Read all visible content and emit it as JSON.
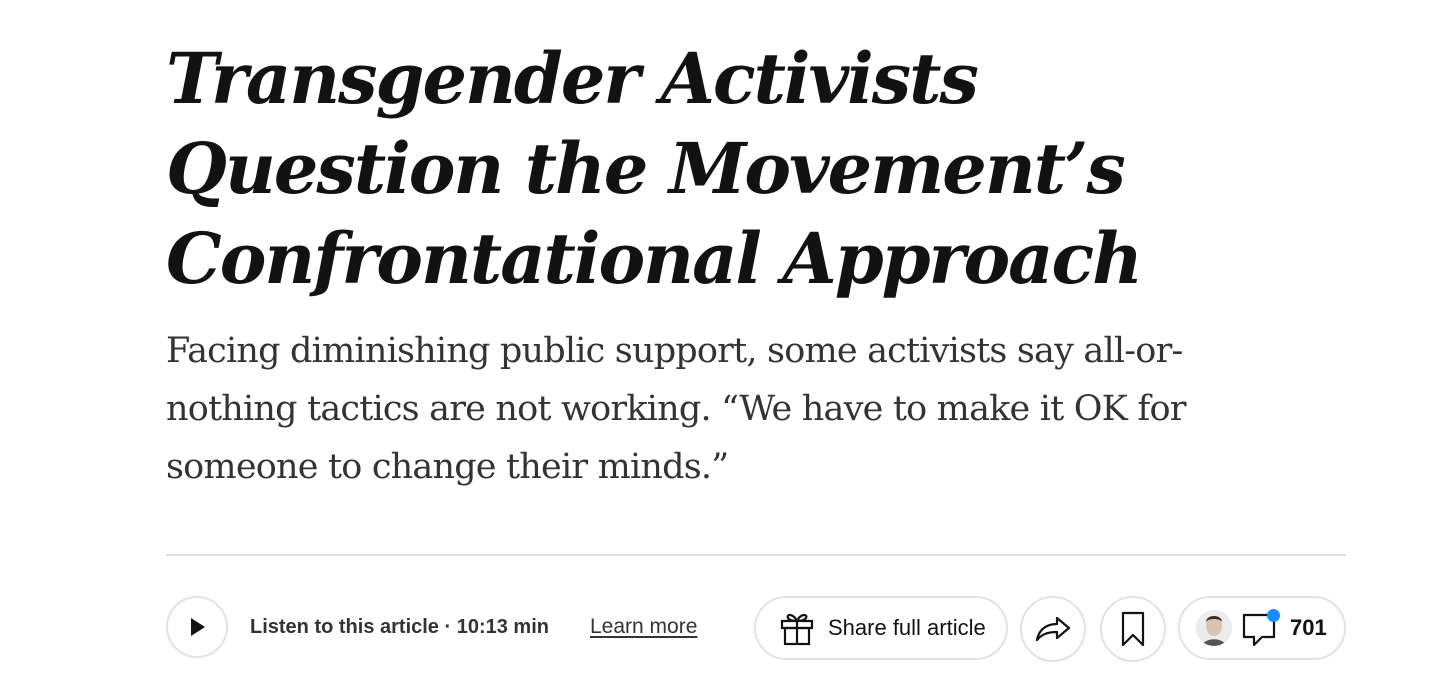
{
  "article": {
    "headline": "Transgender Activists Question the Movement’s Confrontational Approach",
    "summary": "Facing diminishing public support, some activists say all-or-nothing tactics are not working. “We have to make it OK for someone to change their minds.”"
  },
  "toolbar": {
    "listen_label": "Listen to this article · 10:13 min",
    "learn_more_label": "Learn more",
    "share_label": "Share full article",
    "comment_count": "701",
    "icons": {
      "play": "play-icon",
      "gift": "gift-icon",
      "share": "share-arrow-icon",
      "bookmark": "bookmark-icon",
      "comments": "comment-bubble-icon"
    }
  },
  "colors": {
    "text": "#121212",
    "summary_text": "#333333",
    "border": "#e2e2e2",
    "notification_dot": "#1a8cff"
  }
}
